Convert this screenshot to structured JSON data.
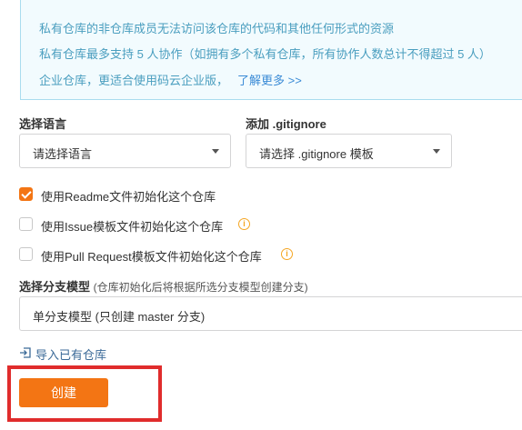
{
  "notice": {
    "line1": "私有仓库的非仓库成员无法访问该仓库的代码和其他任何形式的资源",
    "line2": "私有仓库最多支持 5 人协作（如拥有多个私有仓库，所有协作人数总计不得超过 5 人）",
    "line3": "企业仓库，更适合使用码云企业版，",
    "line3_link": "了解更多 >>"
  },
  "language": {
    "label": "选择语言",
    "value": "请选择语言"
  },
  "gitignore": {
    "label": "添加 .gitignore",
    "value": "请选择 .gitignore 模板"
  },
  "options": [
    {
      "label": "使用Readme文件初始化这个仓库",
      "checked": true
    },
    {
      "label": "使用Issue模板文件初始化这个仓库",
      "checked": false
    },
    {
      "label": "使用Pull Request模板文件初始化这个仓库",
      "checked": false
    }
  ],
  "branch": {
    "title": "选择分支模型",
    "hint": "(仓库初始化后将根据所选分支模型创建分支)",
    "value": "单分支模型 (只创建 master 分支)"
  },
  "import_link": "导入已有仓库",
  "create_button": "创建",
  "colors": {
    "accent": "#f37514",
    "notice_text": "#4a9ebf",
    "highlight": "#e02c2c"
  }
}
